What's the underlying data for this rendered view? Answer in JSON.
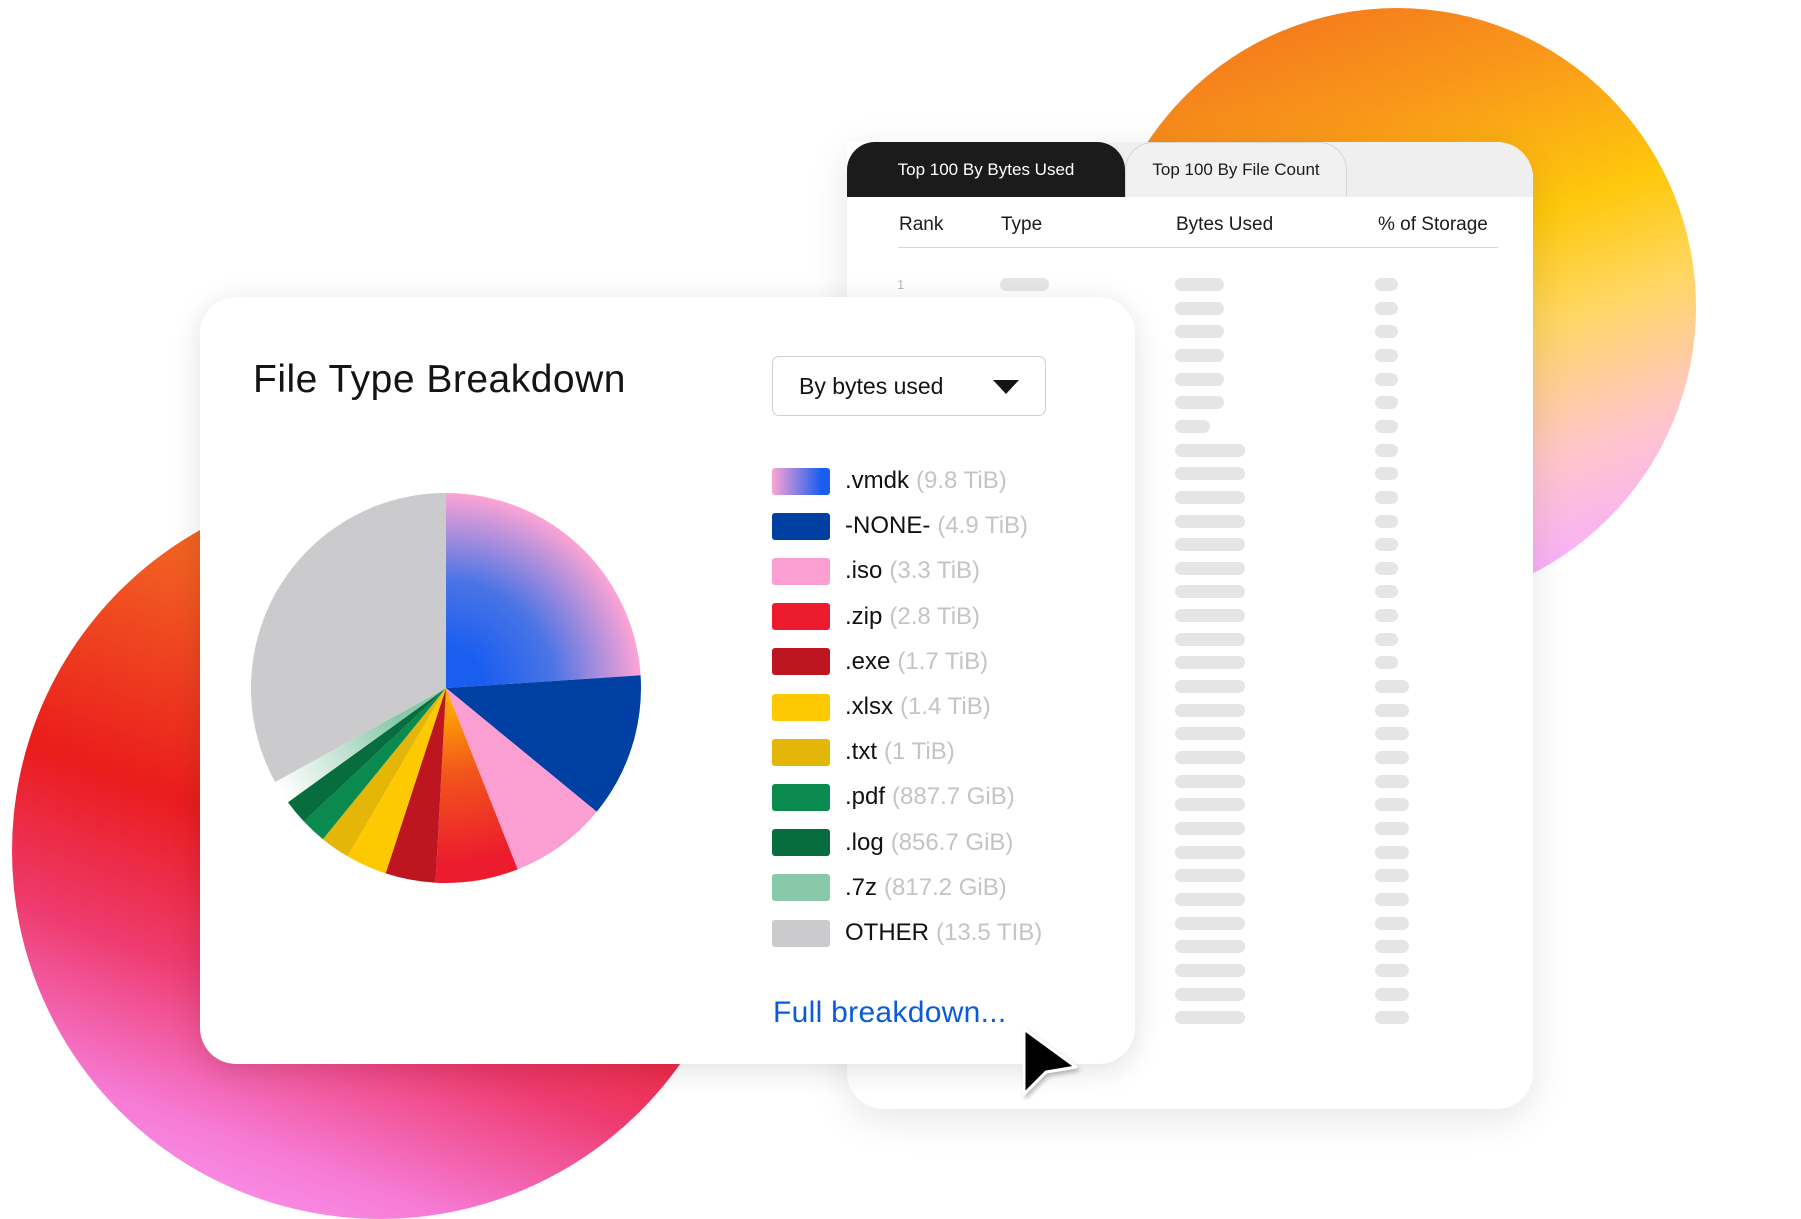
{
  "background": {
    "blobs": [
      "orange-yellow-pink gradient circle (top-right)",
      "orange-red-pink gradient circle (bottom-left)"
    ]
  },
  "top_files_panel": {
    "tabs": [
      {
        "label": "Top 100 By Bytes Used",
        "active": true
      },
      {
        "label": "Top 100 By File Count",
        "active": false
      }
    ],
    "columns": [
      "Rank",
      "Type",
      "Bytes Used",
      "% of Storage"
    ],
    "first_rank": "1",
    "row_count": 32,
    "rows_loading": true
  },
  "file_type_card": {
    "title": "File Type Breakdown",
    "dropdown": {
      "selected": "By bytes used",
      "icon": "triangle-down-icon"
    },
    "full_breakdown_link": "Full breakdown..."
  },
  "chart_data": {
    "type": "pie",
    "title": "File Type Breakdown",
    "metric": "By bytes used",
    "start_angle": "12 o'clock",
    "direction": "clockwise",
    "legend_position": "right",
    "slices": [
      {
        "label": ".vmdk",
        "size_text": "(9.8 TiB)",
        "value_tib": 9.8,
        "color": "#1a5ef0",
        "gradient_from": "#fda4d4"
      },
      {
        "label": "-NONE-",
        "size_text": "(4.9 TiB)",
        "value_tib": 4.9,
        "color": "#0040a3"
      },
      {
        "label": ".iso",
        "size_text": "(3.3 TiB)",
        "value_tib": 3.3,
        "color": "#fb9fd3"
      },
      {
        "label": ".zip",
        "size_text": "(2.8 TiB)",
        "value_tib": 2.8,
        "color": "#ec1c2e",
        "gradient_from": "#ffb000"
      },
      {
        "label": ".exe",
        "size_text": "(1.7 TiB)",
        "value_tib": 1.7,
        "color": "#bd1620"
      },
      {
        "label": ".xlsx",
        "size_text": "(1.4 TiB)",
        "value_tib": 1.4,
        "color": "#fec900"
      },
      {
        "label": ".txt",
        "size_text": "(1 TiB)",
        "value_tib": 1.0,
        "color": "#e4b608"
      },
      {
        "label": ".pdf",
        "size_text": "(887.7 GiB)",
        "value_tib": 0.8669,
        "color": "#0b8a4f"
      },
      {
        "label": ".log",
        "size_text": "(856.7 GiB)",
        "value_tib": 0.8366,
        "color": "#076c3e"
      },
      {
        "label": ".7z",
        "size_text": "(817.2 GiB)",
        "value_tib": 0.798,
        "color": "#88c9a9",
        "gradient_to": "#ffffff"
      },
      {
        "label": "OTHER",
        "size_text": "(13.5   TIB)",
        "value_tib": 13.5,
        "color": "#cbcacd"
      }
    ]
  }
}
